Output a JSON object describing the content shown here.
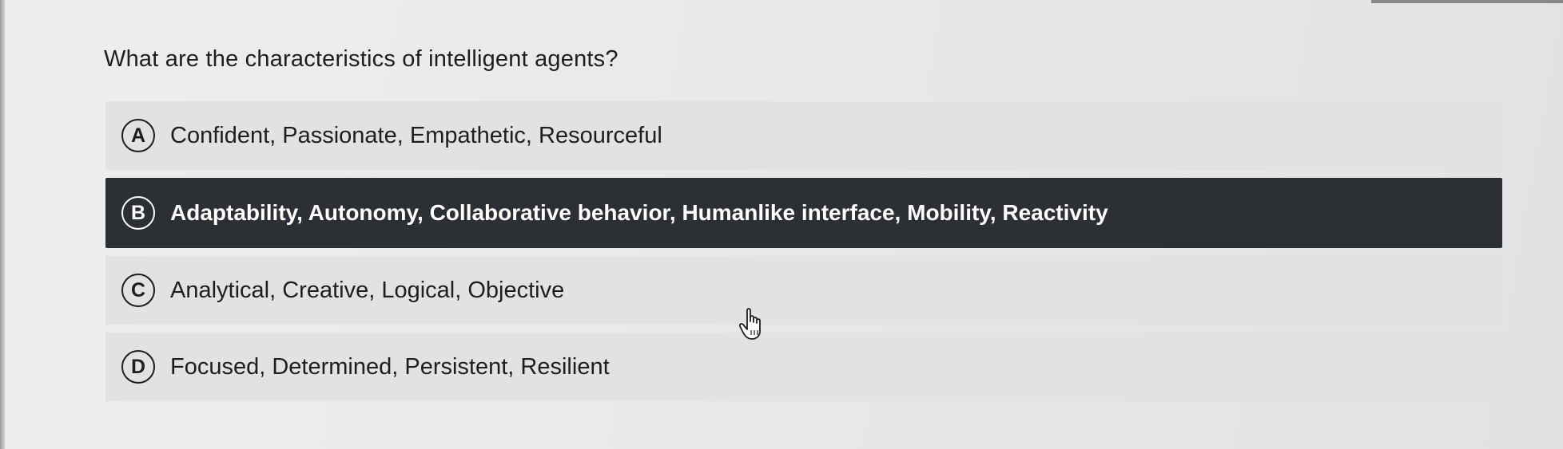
{
  "question": "What are the characteristics of intelligent agents?",
  "options": [
    {
      "letter": "A",
      "text": "Confident, Passionate, Empathetic, Resourceful",
      "selected": false
    },
    {
      "letter": "B",
      "text": "Adaptability, Autonomy, Collaborative behavior, Humanlike interface, Mobility, Reactivity",
      "selected": true
    },
    {
      "letter": "C",
      "text": "Analytical, Creative, Logical, Objective",
      "selected": false
    },
    {
      "letter": "D",
      "text": "Focused, Determined, Persistent, Resilient",
      "selected": false
    }
  ],
  "colors": {
    "selected_background": "#2c2f33",
    "option_background": "#e2e2e2",
    "text": "#1e1e1e"
  },
  "icons": {
    "cursor": "hand-pointer-icon"
  }
}
